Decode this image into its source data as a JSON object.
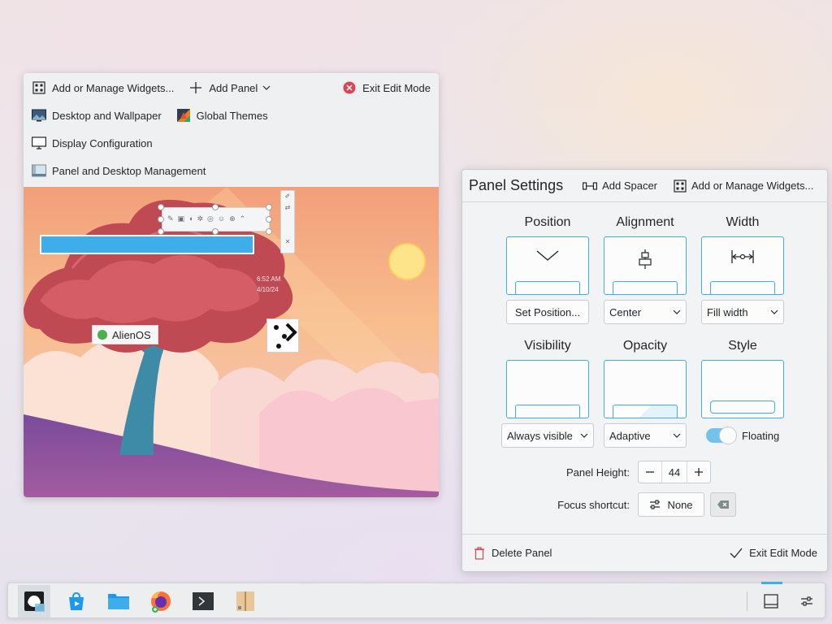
{
  "edit_toolbar": {
    "row1": {
      "add_widgets": "Add or Manage Widgets...",
      "add_panel": "Add Panel",
      "exit_edit_mode": "Exit Edit Mode"
    },
    "row2": {
      "desktop_wallpaper": "Desktop and Wallpaper",
      "global_themes": "Global Themes"
    },
    "row3": {
      "display_configuration": "Display Configuration"
    },
    "row4": {
      "panel_desktop_management": "Panel and Desktop Management"
    }
  },
  "preview": {
    "clock_time": "6:52 AM",
    "clock_date": "4/10/24",
    "alien_label": "AlienOS"
  },
  "panel_settings": {
    "title": "Panel Settings",
    "add_spacer": "Add Spacer",
    "add_widgets": "Add or Manage Widgets...",
    "position": {
      "label": "Position",
      "button": "Set Position..."
    },
    "alignment": {
      "label": "Alignment",
      "value": "Center"
    },
    "width": {
      "label": "Width",
      "value": "Fill width"
    },
    "visibility": {
      "label": "Visibility",
      "value": "Always visible"
    },
    "opacity": {
      "label": "Opacity",
      "value": "Adaptive"
    },
    "style": {
      "label": "Style",
      "toggle_label": "Floating",
      "floating_on": true
    },
    "panel_height": {
      "label": "Panel Height:",
      "value": "44"
    },
    "focus_shortcut": {
      "label": "Focus shortcut:",
      "value": "None"
    },
    "delete_panel": "Delete Panel",
    "exit_edit_mode": "Exit Edit Mode"
  },
  "taskbar": {
    "apps": [
      "application-launcher-icon",
      "discover-icon",
      "file-manager-icon",
      "firefox-icon",
      "terminal-icon",
      "archive-icon"
    ]
  },
  "colors": {
    "accent": "#3daee9",
    "exit_red": "#da4453",
    "window_bg": "#eff0f1"
  }
}
